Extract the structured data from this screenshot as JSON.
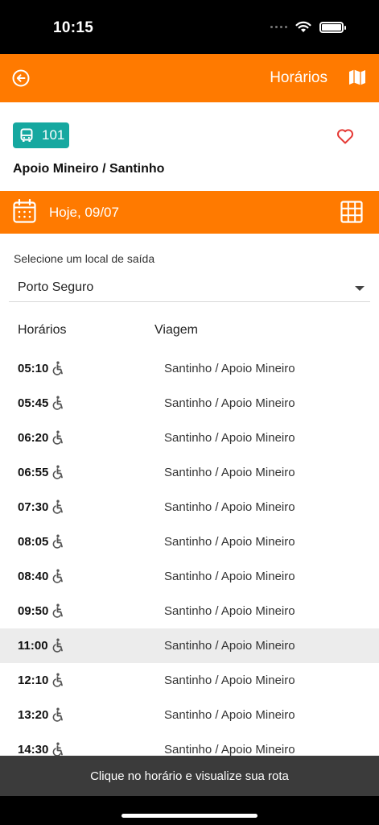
{
  "status_bar": {
    "time": "10:15"
  },
  "header": {
    "title": "Horários"
  },
  "route": {
    "number": "101",
    "name": "Apoio Mineiro / Santinho"
  },
  "date_bar": {
    "label": "Hoje, 09/07"
  },
  "departure": {
    "label": "Selecione um local de saída",
    "selected": "Porto Seguro"
  },
  "table": {
    "col_time": "Horários",
    "col_trip": "Viagem",
    "rows": [
      {
        "time": "05:10",
        "trip": "Santinho / Apoio Mineiro"
      },
      {
        "time": "05:45",
        "trip": "Santinho / Apoio Mineiro"
      },
      {
        "time": "06:20",
        "trip": "Santinho / Apoio Mineiro"
      },
      {
        "time": "06:55",
        "trip": "Santinho / Apoio Mineiro"
      },
      {
        "time": "07:30",
        "trip": "Santinho / Apoio Mineiro"
      },
      {
        "time": "08:05",
        "trip": "Santinho / Apoio Mineiro"
      },
      {
        "time": "08:40",
        "trip": "Santinho / Apoio Mineiro"
      },
      {
        "time": "09:50",
        "trip": "Santinho / Apoio Mineiro"
      },
      {
        "time": "11:00",
        "trip": "Santinho / Apoio Mineiro"
      },
      {
        "time": "12:10",
        "trip": "Santinho / Apoio Mineiro"
      },
      {
        "time": "13:20",
        "trip": "Santinho / Apoio Mineiro"
      },
      {
        "time": "14:30",
        "trip": "Santinho / Apoio Mineiro"
      }
    ],
    "highlighted_time": "11:00"
  },
  "toast": {
    "message": "Clique no horário e visualize sua rota"
  },
  "colors": {
    "accent": "#ff7a00",
    "badge": "#16a8a0",
    "favorite": "#e53935"
  },
  "icons": [
    "back-icon",
    "map-icon",
    "bus-icon",
    "heart-icon",
    "calendar-icon",
    "grid-icon",
    "wheelchair-icon",
    "chevron-down-icon"
  ]
}
